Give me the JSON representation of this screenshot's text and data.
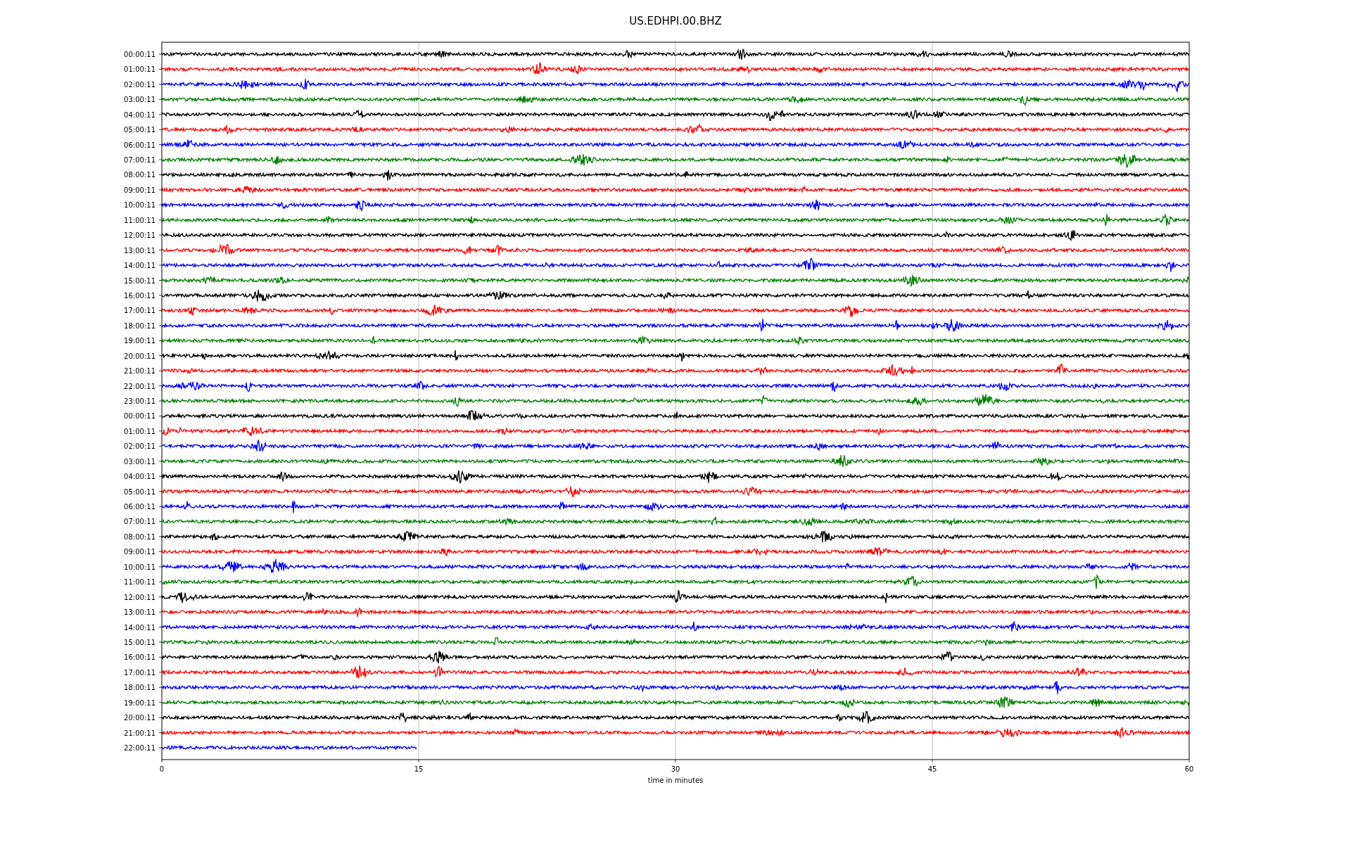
{
  "title": "US.EDHPI.00.BHZ",
  "xlabel": "time in minutes",
  "xticks": [
    "0",
    "15",
    "30",
    "45",
    "60"
  ],
  "rows": [
    {
      "label": "00:00:11",
      "color": "#000000",
      "kind": "full"
    },
    {
      "label": "01:00:11",
      "color": "#ff0000",
      "kind": "full"
    },
    {
      "label": "02:00:11",
      "color": "#0000ff",
      "kind": "full"
    },
    {
      "label": "03:00:11",
      "color": "#008000",
      "kind": "full"
    },
    {
      "label": "04:00:11",
      "color": "#000000",
      "kind": "full"
    },
    {
      "label": "05:00:11",
      "color": "#ff0000",
      "kind": "full"
    },
    {
      "label": "06:00:11",
      "color": "#0000ff",
      "kind": "full"
    },
    {
      "label": "07:00:11",
      "color": "#008000",
      "kind": "full"
    },
    {
      "label": "08:00:11",
      "color": "#000000",
      "kind": "full"
    },
    {
      "label": "09:00:11",
      "color": "#ff0000",
      "kind": "full"
    },
    {
      "label": "10:00:11",
      "color": "#0000ff",
      "kind": "full"
    },
    {
      "label": "11:00:11",
      "color": "#008000",
      "kind": "full"
    },
    {
      "label": "12:00:11",
      "color": "#000000",
      "kind": "full"
    },
    {
      "label": "13:00:11",
      "color": "#ff0000",
      "kind": "full"
    },
    {
      "label": "14:00:11",
      "color": "#0000ff",
      "kind": "full"
    },
    {
      "label": "15:00:11",
      "color": "#008000",
      "kind": "full"
    },
    {
      "label": "16:00:11",
      "color": "#000000",
      "kind": "full"
    },
    {
      "label": "17:00:11",
      "color": "#ff0000",
      "kind": "full"
    },
    {
      "label": "18:00:11",
      "color": "#0000ff",
      "kind": "full"
    },
    {
      "label": "19:00:11",
      "color": "#008000",
      "kind": "full"
    },
    {
      "label": "20:00:11",
      "color": "#000000",
      "kind": "full"
    },
    {
      "label": "21:00:11",
      "color": "#ff0000",
      "kind": "full"
    },
    {
      "label": "22:00:11",
      "color": "#0000ff",
      "kind": "full"
    },
    {
      "label": "23:00:11",
      "color": "#008000",
      "kind": "full"
    },
    {
      "label": "00:00:11",
      "color": "#000000",
      "kind": "full"
    },
    {
      "label": "01:00:11",
      "color": "#ff0000",
      "kind": "full"
    },
    {
      "label": "02:00:11",
      "color": "#0000ff",
      "kind": "full"
    },
    {
      "label": "03:00:11",
      "color": "#008000",
      "kind": "full"
    },
    {
      "label": "04:00:11",
      "color": "#000000",
      "kind": "full"
    },
    {
      "label": "05:00:11",
      "color": "#ff0000",
      "kind": "full"
    },
    {
      "label": "06:00:11",
      "color": "#0000ff",
      "kind": "full"
    },
    {
      "label": "07:00:11",
      "color": "#008000",
      "kind": "full"
    },
    {
      "label": "08:00:11",
      "color": "#000000",
      "kind": "full"
    },
    {
      "label": "09:00:11",
      "color": "#ff0000",
      "kind": "full"
    },
    {
      "label": "10:00:11",
      "color": "#0000ff",
      "kind": "full"
    },
    {
      "label": "11:00:11",
      "color": "#008000",
      "kind": "full"
    },
    {
      "label": "12:00:11",
      "color": "#000000",
      "kind": "full"
    },
    {
      "label": "13:00:11",
      "color": "#ff0000",
      "kind": "full"
    },
    {
      "label": "14:00:11",
      "color": "#0000ff",
      "kind": "full"
    },
    {
      "label": "15:00:11",
      "color": "#008000",
      "kind": "full"
    },
    {
      "label": "16:00:11",
      "color": "#000000",
      "kind": "full"
    },
    {
      "label": "17:00:11",
      "color": "#ff0000",
      "kind": "full"
    },
    {
      "label": "18:00:11",
      "color": "#0000ff",
      "kind": "full"
    },
    {
      "label": "19:00:11",
      "color": "#008000",
      "kind": "full"
    },
    {
      "label": "20:00:11",
      "color": "#000000",
      "kind": "full"
    },
    {
      "label": "21:00:11",
      "color": "#ff0000",
      "kind": "full"
    },
    {
      "label": "22:00:11",
      "color": "#0000ff",
      "kind": "partial"
    }
  ]
}
